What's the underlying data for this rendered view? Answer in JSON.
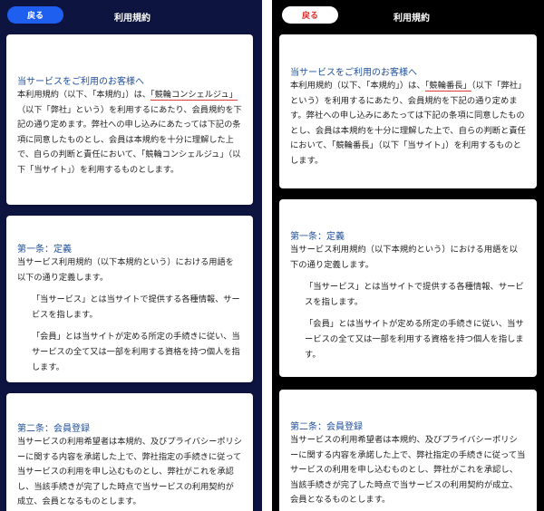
{
  "left": {
    "header": {
      "back_label": "戻る",
      "title": "利用規約"
    },
    "intro": {
      "heading": "当サービスをご利用のお客様へ",
      "text_before": "本利用規約（以下、「本規約」）は、",
      "highlight": "「競輪コンシェルジュ」",
      "text_after": "（以下「弊社」という）を利用するにあたり、会員規約を下記の通り定めます。弊社への申し込みにあたっては下記の条項に同意したものとし、会員は本規約を十分に理解した上で、自らの判断と責任において、「競輪コンシェルジュ」（以下「当サイト」）を利用するものとします。"
    },
    "article1": {
      "heading": "第一条：定義",
      "text": "当サービス利用規約（以下本規約という）における用語を以下の通り定義します。",
      "items": [
        "「当サービス」とは当サイトで提供する各種情報、サービスを指します。",
        "「会員」とは当サイトが定める所定の手続きに従い、当サービスの全て又は一部を利用する資格を持つ個人を指します。"
      ]
    },
    "article2": {
      "heading": "第二条：会員登録",
      "text": "当サービスの利用希望者は本規約、及びプライバシーポリシーに関する内容を承諾した上で、弊社指定の手続きに従って当サービスの利用を申し込むものとし、弊社がこれを承認し、当該手続きが完了した時点で当サービスの利用契約が成立、会員となるものとします。"
    }
  },
  "right": {
    "header": {
      "back_label": "戻る",
      "title": "利用規約"
    },
    "intro": {
      "heading": "当サービスをご利用のお客様へ",
      "text_before": "本利用規約（以下、「本規約」）は、",
      "highlight": "「競輪番長」",
      "text_after": "（以下「弊社」という）を利用するにあたり、会員規約を下記の通り定めます。弊社への申し込みにあたっては下記の条項に同意したものとし、会員は本規約を十分に理解した上で、自らの判断と責任において、「競輪番長」（以下「当サイト」）を利用するものとします。"
    },
    "article1": {
      "heading": "第一条：定義",
      "text": "当サービス利用規約（以下本規約という）における用語を以下の通り定義します。",
      "items": [
        "「当サービス」とは当サイトで提供する各種情報、サービスを指します。",
        "「会員」とは当サイトが定める所定の手続きに従い、当サービスの全て又は一部を利用する資格を持つ個人を指します。"
      ]
    },
    "article2": {
      "heading": "第二条：会員登録",
      "text": "当サービスの利用希望者は本規約、及びプライバシーポリシーに関する内容を承諾した上で、弊社指定の手続きに従って当サービスの利用を申し込むものとし、弊社がこれを承認し、当該手続きが完了した時点で当サービスの利用契約が成立、会員となるものとします。"
    }
  },
  "colors": {
    "left_background": "#0d1440",
    "right_background": "#000000",
    "left_back_button": "#1e5ff0",
    "right_back_text": "#e03030",
    "heading_blue": "#1f4f9a",
    "highlight_underline": "#e53935"
  }
}
